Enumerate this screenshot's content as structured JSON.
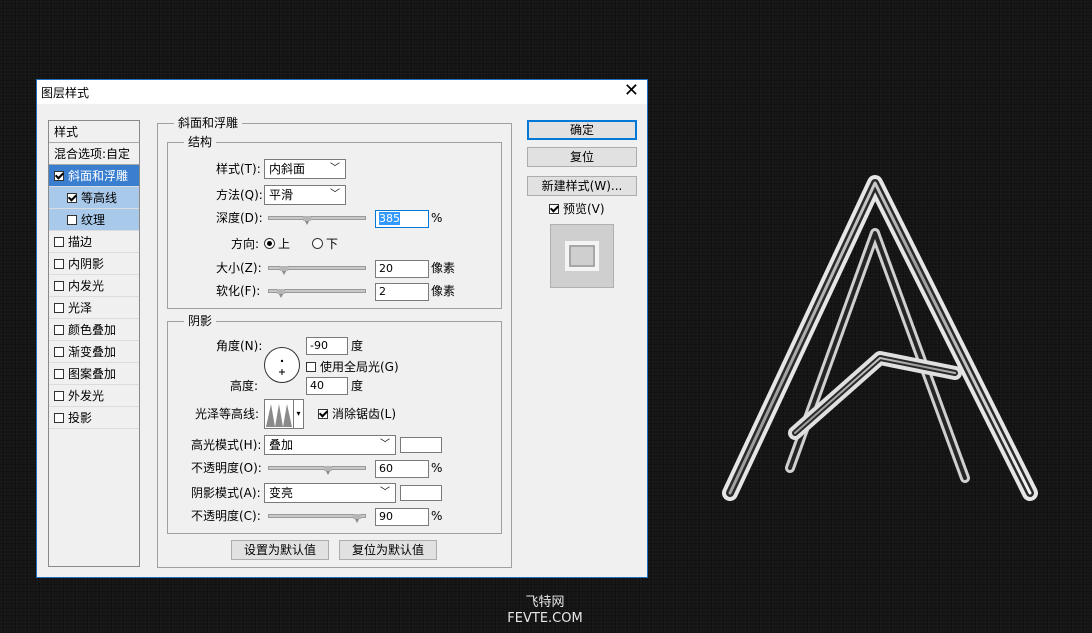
{
  "dialog": {
    "title": "图层样式",
    "close_glyph": "✕"
  },
  "styles_list": {
    "header": "样式",
    "blend_options": "混合选项:自定",
    "items": [
      {
        "label": "斜面和浮雕",
        "checked": true,
        "selected": true
      },
      {
        "label": "等高线",
        "checked": true,
        "sub": true
      },
      {
        "label": "纹理",
        "checked": false,
        "sub": true
      },
      {
        "label": "描边",
        "checked": false
      },
      {
        "label": "内阴影",
        "checked": false
      },
      {
        "label": "内发光",
        "checked": false
      },
      {
        "label": "光泽",
        "checked": false
      },
      {
        "label": "颜色叠加",
        "checked": false
      },
      {
        "label": "渐变叠加",
        "checked": false
      },
      {
        "label": "图案叠加",
        "checked": false
      },
      {
        "label": "外发光",
        "checked": false
      },
      {
        "label": "投影",
        "checked": false
      }
    ]
  },
  "bevel": {
    "section_title": "斜面和浮雕",
    "structure": {
      "title": "结构",
      "style_label": "样式(T):",
      "style_value": "内斜面",
      "technique_label": "方法(Q):",
      "technique_value": "平滑",
      "depth_label": "深度(D):",
      "depth_value": "385",
      "depth_unit": "%",
      "direction_label": "方向:",
      "dir_up": "上",
      "dir_down": "下",
      "size_label": "大小(Z):",
      "size_value": "20",
      "size_unit": "像素",
      "soften_label": "软化(F):",
      "soften_value": "2",
      "soften_unit": "像素"
    },
    "shading": {
      "title": "阴影",
      "angle_label": "角度(N):",
      "angle_value": "-90",
      "angle_unit": "度",
      "global_light_label": "使用全局光(G)",
      "altitude_label": "高度:",
      "altitude_value": "40",
      "altitude_unit": "度",
      "gloss_contour_label": "光泽等高线:",
      "anti_alias_label": "消除锯齿(L)",
      "highlight_mode_label": "高光模式(H):",
      "highlight_mode_value": "叠加",
      "highlight_opacity_label": "不透明度(O):",
      "highlight_opacity_value": "60",
      "highlight_opacity_unit": "%",
      "shadow_mode_label": "阴影模式(A):",
      "shadow_mode_value": "变亮",
      "shadow_opacity_label": "不透明度(C):",
      "shadow_opacity_value": "90",
      "shadow_opacity_unit": "%"
    },
    "make_default": "设置为默认值",
    "reset_default": "复位为默认值"
  },
  "buttons": {
    "ok": "确定",
    "reset": "复位",
    "new_style": "新建样式(W)...",
    "preview_label": "预览(V)"
  },
  "watermark": {
    "line1": "飞特网",
    "line2": "FEVTE.COM"
  }
}
